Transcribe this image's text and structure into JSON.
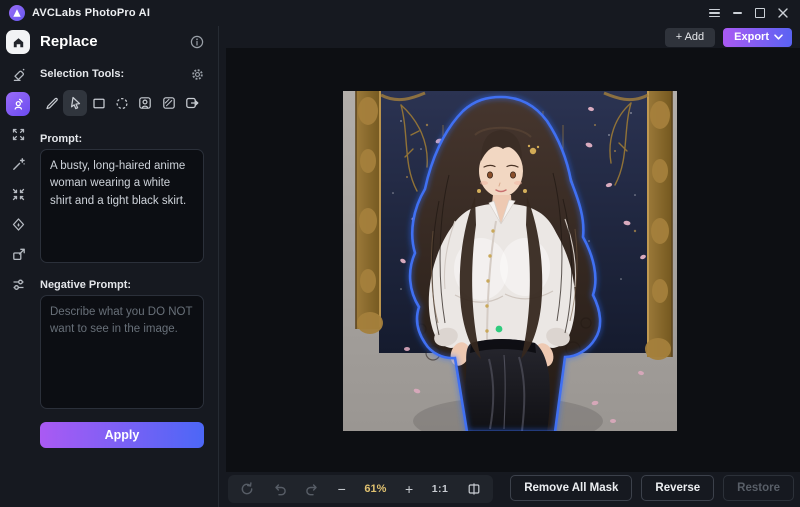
{
  "app": {
    "title": "AVCLabs PhotoPro AI"
  },
  "rail": {
    "items": [
      "home",
      "cleanup",
      "replace",
      "enhance",
      "magic-wand",
      "compress",
      "colorize",
      "resize",
      "adjust"
    ],
    "active": "replace"
  },
  "panel": {
    "title": "Replace",
    "selection_tools_label": "Selection Tools:",
    "tools": [
      "brush",
      "lasso",
      "rectangle-select",
      "ellipse-select",
      "subject-select",
      "pattern-mask",
      "move-selection"
    ],
    "active_tool": "lasso",
    "prompt_label": "Prompt:",
    "prompt_value": "A busty, long-haired anime woman wearing a white shirt and a tight black skirt.",
    "negative_prompt_label": "Negative Prompt:",
    "negative_prompt_placeholder": "Describe what you DO NOT want to see in the image.",
    "apply_label": "Apply"
  },
  "stage": {
    "add_label": "+ Add",
    "export_label": "Export",
    "toolbar": {
      "zoom_out": "−",
      "zoom_value": "61%",
      "zoom_in": "+",
      "ratio_label": "1:1"
    },
    "actions": {
      "remove_all_mask_label": "Remove All Mask",
      "reverse_label": "Reverse",
      "restore_label": "Restore"
    }
  },
  "icons": {
    "titlebar": [
      "app-logo-icon",
      "menu-icon",
      "minimize-icon",
      "maximize-icon",
      "close-icon"
    ],
    "panel": [
      "info-icon",
      "gear-icon"
    ],
    "toolbar": [
      "reset-icon",
      "undo-icon",
      "redo-icon",
      "compare-icon"
    ],
    "export": [
      "chevron-down-icon"
    ]
  },
  "colors": {
    "accent_gradient_start": "#aa5af3",
    "accent_gradient_end": "#4c67f6",
    "zoom_value_color": "#dfc170",
    "mask_outline_color": "#3f6ff2",
    "mask_marker_color": "#2fcb7d"
  }
}
